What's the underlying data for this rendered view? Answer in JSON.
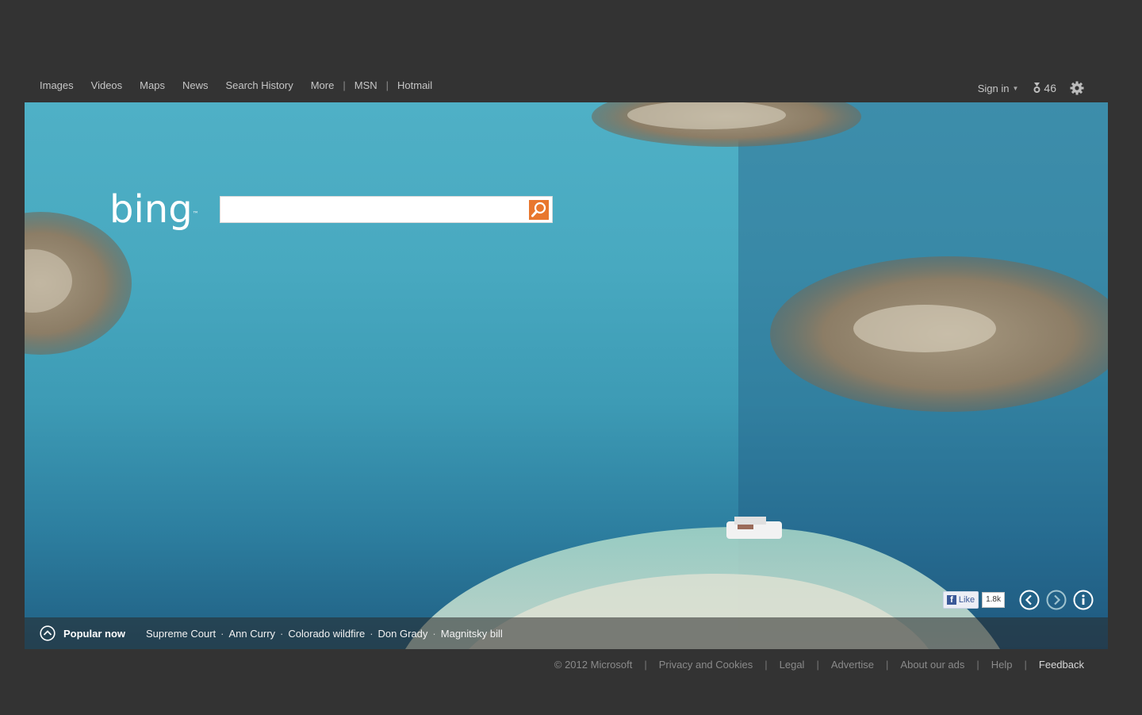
{
  "nav": {
    "images": "Images",
    "videos": "Videos",
    "maps": "Maps",
    "news": "News",
    "search_history": "Search History",
    "more": "More",
    "msn": "MSN",
    "hotmail": "Hotmail",
    "separator": "|"
  },
  "account": {
    "sign_in": "Sign in",
    "rewards_count": "46"
  },
  "brand": {
    "logo_text": "bing",
    "trademark": "™",
    "accent_color": "#e8772e"
  },
  "search": {
    "value": "",
    "placeholder": ""
  },
  "social": {
    "like_label": "Like",
    "like_count": "1.8k"
  },
  "popular": {
    "title": "Popular now",
    "items": [
      "Supreme Court",
      "Ann Curry",
      "Colorado wildfire",
      "Don Grady",
      "Magnitsky bill"
    ],
    "separator": "·"
  },
  "footer": {
    "copyright": "© 2012 Microsoft",
    "privacy": "Privacy and Cookies",
    "legal": "Legal",
    "advertise": "Advertise",
    "about_ads": "About our ads",
    "help": "Help",
    "feedback": "Feedback",
    "separator": "|"
  },
  "icons": {
    "search": "search-icon",
    "gear": "gear-icon",
    "rewards": "rewards-medal-icon",
    "prev": "chevron-left-icon",
    "next": "chevron-right-icon",
    "info": "info-icon",
    "popular_toggle": "chevron-up-icon"
  }
}
